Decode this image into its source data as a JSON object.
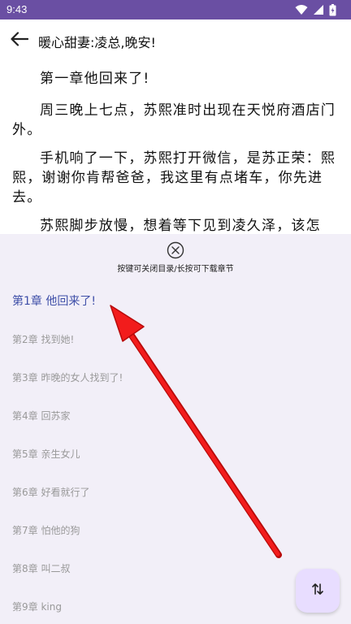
{
  "status_bar": {
    "time": "9:43",
    "icons": [
      "wifi-icon",
      "cell-signal-icon",
      "battery-icon"
    ]
  },
  "app_bar": {
    "back_icon": "arrow-left-icon",
    "title": "暖心甜妻:凌总,晚安!"
  },
  "reader": {
    "paragraphs": [
      "第一章他回来了!",
      "周三晚上七点，苏熙准时出现在天悦府酒店门外。",
      "手机响了一下，苏熙打开微信，是苏正荣：熙熙，谢谢你肯帮爸爸，我这里有点堵车，你先进去。",
      "苏熙脚步放慢，想着等下见到凌久泽，该怎"
    ]
  },
  "toc": {
    "close_icon": "close-circle-icon",
    "hint": "按键可关闭目录/长按可下载章节",
    "chapters": [
      "第1章 他回来了!",
      "第2章 找到她!",
      "第3章 昨晚的女人找到了!",
      "第4章 回苏家",
      "第5章 亲生女儿",
      "第6章 好看就行了",
      "第7章 怕他的狗",
      "第8章 叫二叔",
      "第9章 king"
    ],
    "active_index": 0
  },
  "fab": {
    "icon": "sort-swap-icon"
  },
  "colors": {
    "status_bar": "#6a4fa3",
    "panel_bg": "#f2eff8",
    "active_chapter": "#3f4fa8",
    "inactive_chapter": "#999999",
    "fab_bg": "#e8ddff",
    "annotation_arrow": "#e81010"
  }
}
